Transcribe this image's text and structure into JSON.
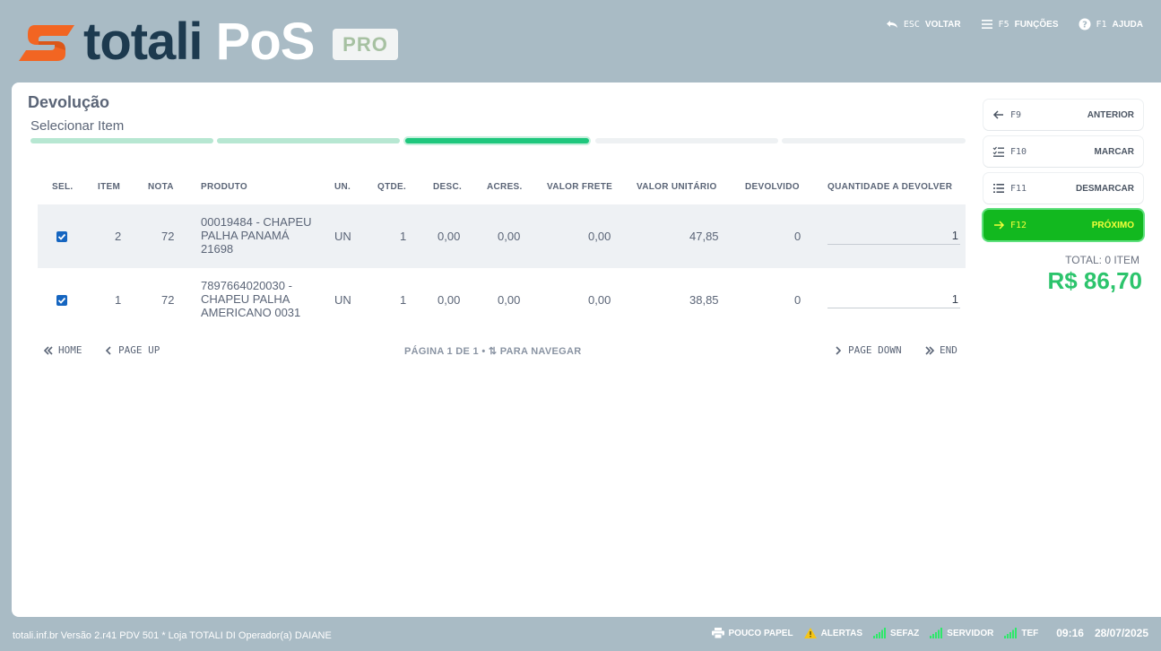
{
  "brand": {
    "name_part1": "totali",
    "name_part2": "PoS",
    "badge": "PRO"
  },
  "top_actions": [
    {
      "key": "ESC",
      "label": "VOLTAR"
    },
    {
      "key": "F5",
      "label": "FUNÇÕES"
    },
    {
      "key": "F1",
      "label": "AJUDA"
    }
  ],
  "page": {
    "title": "Devolução",
    "step_title": "Selecionar Item"
  },
  "table": {
    "headers": {
      "sel": "SEL.",
      "item": "ITEM",
      "nota": "NOTA",
      "produto": "PRODUTO",
      "un": "UN.",
      "qtde": "QTDE.",
      "desc": "DESC.",
      "acres": "ACRES.",
      "frete": "VALOR FRETE",
      "unit": "VALOR UNITÁRIO",
      "devolvido": "DEVOLVIDO",
      "qtd_dev": "QUANTIDADE A DEVOLVER"
    },
    "rows": [
      {
        "selected": true,
        "item": "2",
        "nota": "72",
        "produto": "00019484 - CHAPEU PALHA PANAMÁ 21698",
        "un": "UN",
        "qtde": "1",
        "desc": "0,00",
        "acres": "0,00",
        "frete": "0,00",
        "unit": "47,85",
        "devolvido": "0",
        "qtd_dev": "1"
      },
      {
        "selected": true,
        "item": "1",
        "nota": "72",
        "produto": "7897664020030 - CHAPEU PALHA AMERICANO 0031",
        "un": "UN",
        "qtde": "1",
        "desc": "0,00",
        "acres": "0,00",
        "frete": "0,00",
        "unit": "38,85",
        "devolvido": "0",
        "qtd_dev": "1"
      }
    ]
  },
  "pager": {
    "home": "HOME",
    "page_up": "PAGE UP",
    "page_down": "PAGE DOWN",
    "end": "END",
    "info": "PÁGINA 1 DE 1 • ⇅ PARA NAVEGAR"
  },
  "side_buttons": [
    {
      "key": "F9",
      "label": "ANTERIOR"
    },
    {
      "key": "F10",
      "label": "MARCAR"
    },
    {
      "key": "F11",
      "label": "DESMARCAR"
    },
    {
      "key": "F12",
      "label": "PRÓXIMO"
    }
  ],
  "totals": {
    "label": "TOTAL: 0 ITEM",
    "value": "R$ 86,70"
  },
  "footer": {
    "left": "totali.inf.br Versão 2.r41 PDV 501  *  Loja TOTALI DI Operador(a) DAIANE",
    "status": [
      "POUCO PAPEL",
      "ALERTAS",
      "SEFAZ",
      "SERVIDOR",
      "TEF"
    ],
    "time": "09:16",
    "date": "28/07/2025"
  },
  "colors": {
    "accent_green": "#2cc46c",
    "primary_button": "#12b81f",
    "brand_orange": "#f26522",
    "brand_navy": "#1d3a4f"
  }
}
